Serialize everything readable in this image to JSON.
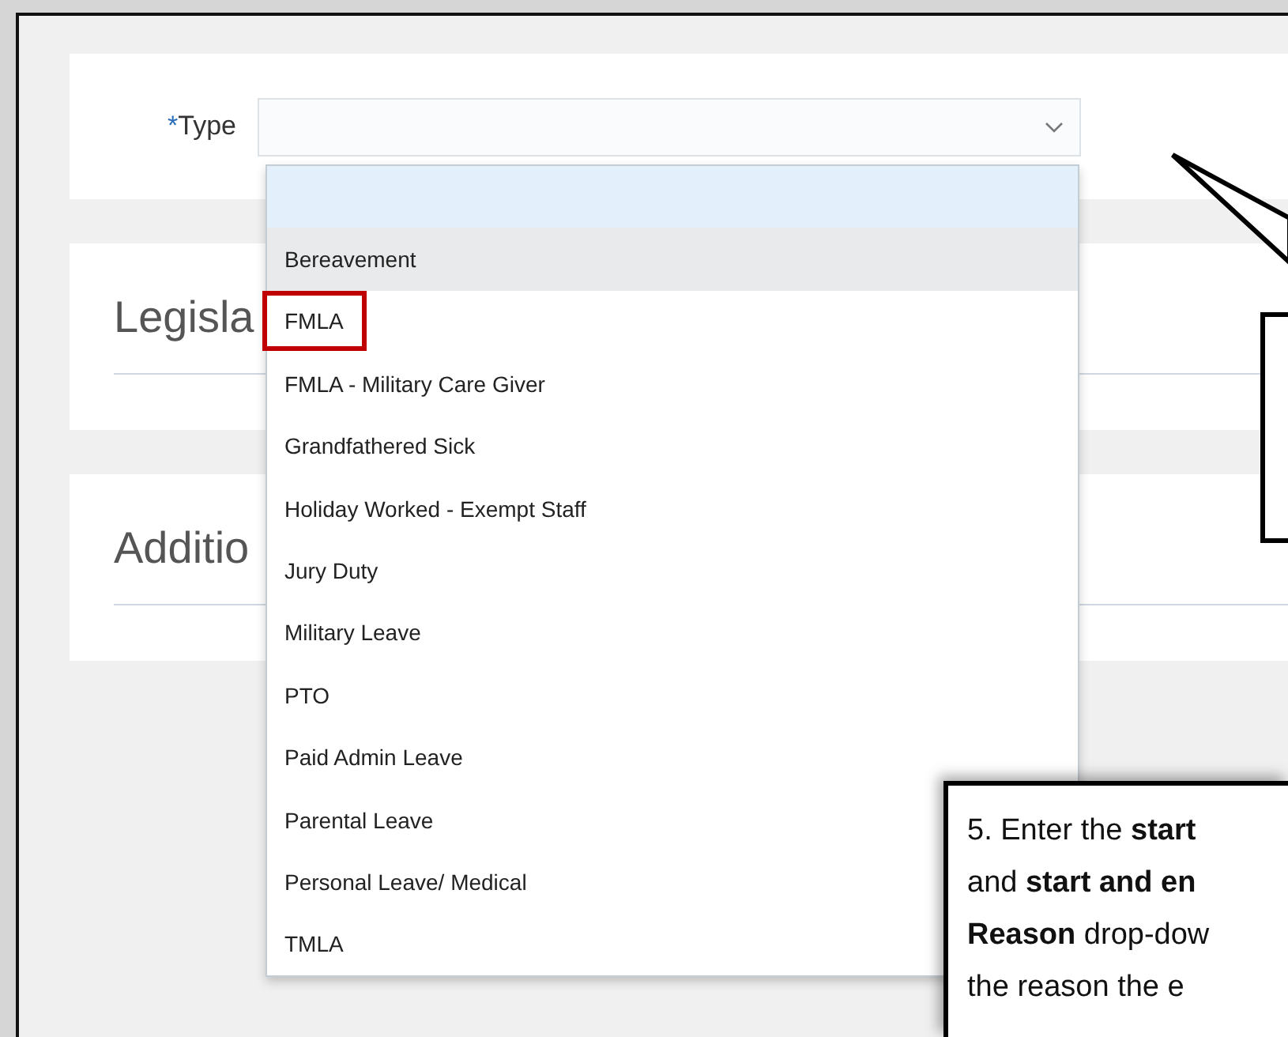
{
  "type_field": {
    "label": "Type",
    "required_mark": "*"
  },
  "sections": [
    {
      "title": "Legisla"
    },
    {
      "title": "Additio"
    }
  ],
  "dropdown": {
    "options": [
      {
        "kind": "blank",
        "selected": true,
        "hovered": false,
        "outlined": false
      },
      {
        "kind": "option",
        "label": "Bereavement",
        "selected": false,
        "hovered": true,
        "outlined": false
      },
      {
        "kind": "option",
        "label": "FMLA",
        "selected": false,
        "hovered": false,
        "outlined": true
      },
      {
        "kind": "option",
        "label": "FMLA - Military Care Giver",
        "selected": false,
        "hovered": false,
        "outlined": false
      },
      {
        "kind": "option",
        "label": "Grandfathered Sick",
        "selected": false,
        "hovered": false,
        "outlined": false
      },
      {
        "kind": "option",
        "label": "Holiday Worked - Exempt Staff",
        "selected": false,
        "hovered": false,
        "outlined": false
      },
      {
        "kind": "option",
        "label": "Jury Duty",
        "selected": false,
        "hovered": false,
        "outlined": false
      },
      {
        "kind": "option",
        "label": "Military Leave",
        "selected": false,
        "hovered": false,
        "outlined": false
      },
      {
        "kind": "option",
        "label": "PTO",
        "selected": false,
        "hovered": false,
        "outlined": false
      },
      {
        "kind": "option",
        "label": "Paid Admin Leave",
        "selected": false,
        "hovered": false,
        "outlined": false
      },
      {
        "kind": "option",
        "label": "Parental Leave",
        "selected": false,
        "hovered": false,
        "outlined": false
      },
      {
        "kind": "option",
        "label": "Personal Leave/ Medical",
        "selected": false,
        "hovered": false,
        "outlined": false
      },
      {
        "kind": "option",
        "label": "TMLA",
        "selected": false,
        "hovered": false,
        "outlined": false
      }
    ]
  },
  "callouts": [
    {
      "kind": "bubble"
    },
    {
      "kind": "box",
      "lines": [
        "5. Enter the **start**",
        "and **start and en**",
        "**Reason** drop-dow",
        "the reason the e"
      ]
    }
  ]
}
